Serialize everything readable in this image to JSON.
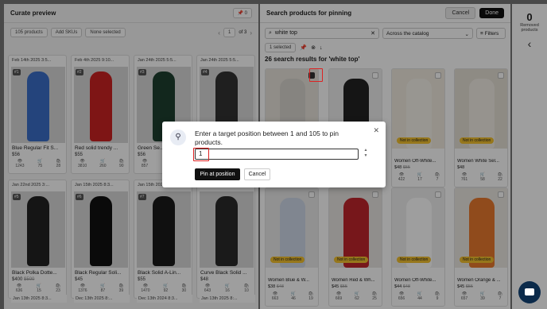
{
  "left": {
    "title": "Curate preview",
    "pin_count": "0",
    "count_dropdown": "105 products",
    "add_skus": "Add SKUs",
    "none_selected": "None selected",
    "page_value": "1",
    "page_total": "of 3",
    "cards": [
      {
        "date": "Feb 14th 2025 3:5...",
        "num": "#1",
        "title": "Blue Regular Fit S...",
        "price": "$56",
        "s1": "1243",
        "s2": "75",
        "s3": "28",
        "color": "#3a6fc9"
      },
      {
        "date": "Feb 4th 2025 9:10...",
        "num": "#2",
        "title": "Red solid trendy ...",
        "price": "$55",
        "s1": "3810",
        "s2": "260",
        "s3": "90",
        "color": "#cc2222"
      },
      {
        "date": "Jan 24th 2025 5:5...",
        "num": "#3",
        "title": "Green Se...",
        "price": "$56",
        "s1": "857",
        "s2": "",
        "s3": "",
        "color": "#1e4030"
      },
      {
        "date": "Jan 24th 2025 5:5...",
        "num": "#4",
        "title": "",
        "price": "",
        "s1": "",
        "s2": "",
        "s3": "",
        "color": "#333"
      },
      {
        "date": "Jan 22nd 2025 3:...",
        "num": "#5",
        "title": "Black Polka Dotte...",
        "price": "$400",
        "old": "$500",
        "s1": "636",
        "s2": "15",
        "s3": "23",
        "color": "#222"
      },
      {
        "date": "Jan 15th 2025 8:3...",
        "num": "#6",
        "title": "Black Regular Soli...",
        "price": "$45",
        "s1": "1376",
        "s2": "87",
        "s3": "39",
        "color": "#111"
      },
      {
        "date": "Jan 15th 2025 8:3...",
        "num": "#7",
        "title": "Black Solid A-Lin...",
        "price": "$55",
        "s1": "1470",
        "s2": "92",
        "s3": "30",
        "color": "#1a1a1a"
      },
      {
        "date": "Jan 14th 2025 8:3...",
        "num": "",
        "title": "Curve Black Solid ...",
        "price": "$48",
        "s1": "643",
        "s2": "16",
        "s3": "10",
        "color": "#2a2a2a"
      }
    ],
    "bottom_dates": [
      "Jan 13th 2025 8:3...",
      "Dec 13th 2025 8:...",
      "Dec 13th 2024 8:3...",
      "Jan 13th 2025 8:..."
    ]
  },
  "right": {
    "title": "Search products for pinning",
    "cancel": "Cancel",
    "done": "Done",
    "search_value": "white top",
    "scope": "Across the catalog",
    "filters": "Filters",
    "selected": "1 selected",
    "results": "26 search results for 'white top'",
    "badge_text": "Not in collection",
    "cards": [
      {
        "title": "",
        "price": "",
        "s1": "",
        "s2": "",
        "s3": "",
        "color": "#e8e4dc"
      },
      {
        "title": "",
        "price": "",
        "s1": "",
        "s2": "",
        "s3": "",
        "color": "#eeeeee"
      },
      {
        "title": "Women Off-White...",
        "price": "$48",
        "old": "$55",
        "s1": "422",
        "s2": "17",
        "s3": "7",
        "color": "#f0eadf"
      },
      {
        "title": "Women White Sel...",
        "price": "$48",
        "s1": "761",
        "s2": "58",
        "s3": "22",
        "color": "#e6e0d6"
      },
      {
        "title": "Women Blue & W...",
        "price": "$38",
        "old": "$48",
        "s1": "663",
        "s2": "46",
        "s3": "19",
        "color": "#eaeaea"
      },
      {
        "title": "Women Red & Wh...",
        "price": "$45",
        "old": "$55",
        "s1": "669",
        "s2": "62",
        "s3": "25",
        "color": "#e9e6e2"
      },
      {
        "title": "Women Off-White...",
        "price": "$44",
        "old": "$48",
        "s1": "656",
        "s2": "44",
        "s3": "9",
        "color": "#efefef"
      },
      {
        "title": "Women Orange & ...",
        "price": "$45",
        "old": "$55",
        "s1": "657",
        "s2": "39",
        "s3": "7",
        "color": "#ece8e2"
      }
    ]
  },
  "strip": {
    "count": "0",
    "label": "Removed products"
  },
  "modal": {
    "text": "Enter a target position between 1 and 105 to pin products.",
    "input_value": "1",
    "pin_button": "Pin at position",
    "cancel_button": "Cancel"
  }
}
